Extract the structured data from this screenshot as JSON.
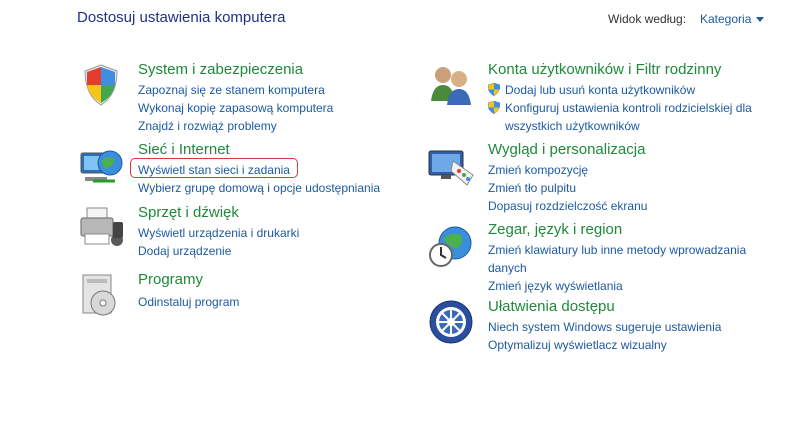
{
  "header": {
    "title": "Dostosuj ustawienia komputera",
    "view_by_label": "Widok według:",
    "view_by_value": "Kategoria"
  },
  "left": [
    {
      "title": "System i zabezpieczenia",
      "icon": "shield-icon",
      "links": [
        "Zapoznaj się ze stanem komputera",
        "Wykonaj kopię zapasową komputera",
        "Znajdź i rozwiąż problemy"
      ]
    },
    {
      "title": "Sieć i Internet",
      "icon": "network-globe-icon",
      "links": [
        "Wyświetl stan sieci i zadania",
        "Wybierz grupę domową i opcje udostępniania"
      ]
    },
    {
      "title": "Sprzęt i dźwięk",
      "icon": "printer-icon",
      "links": [
        "Wyświetl urządzenia i drukarki",
        "Dodaj urządzenie"
      ]
    },
    {
      "title": "Programy",
      "icon": "programs-icon",
      "links": [
        "Odinstaluj program"
      ]
    }
  ],
  "right": [
    {
      "title": "Konta użytkowników i Filtr rodzinny",
      "icon": "users-icon",
      "links": [
        "Dodaj lub usuń konta użytkowników",
        "Konfiguruj ustawienia kontroli rodzicielskiej dla wszystkich użytkowników"
      ]
    },
    {
      "title": "Wygląd i personalizacja",
      "icon": "display-palette-icon",
      "links": [
        "Zmień kompozycję",
        "Zmień tło pulpitu",
        "Dopasuj rozdzielczość ekranu"
      ]
    },
    {
      "title": "Zegar, język i region",
      "icon": "clock-globe-icon",
      "links": [
        "Zmień klawiatury lub inne metody wprowadzania danych",
        "Zmień język wyświetlania"
      ]
    },
    {
      "title": "Ułatwienia dostępu",
      "icon": "accessibility-icon",
      "links": [
        "Niech system Windows sugeruje ustawienia",
        "Optymalizuj wyświetlacz wizualny"
      ]
    }
  ],
  "colors": {
    "category_title": "#1e8a3a",
    "link": "#1e5aa0",
    "page_title": "#1e3287",
    "highlight": "#d63a3a"
  }
}
